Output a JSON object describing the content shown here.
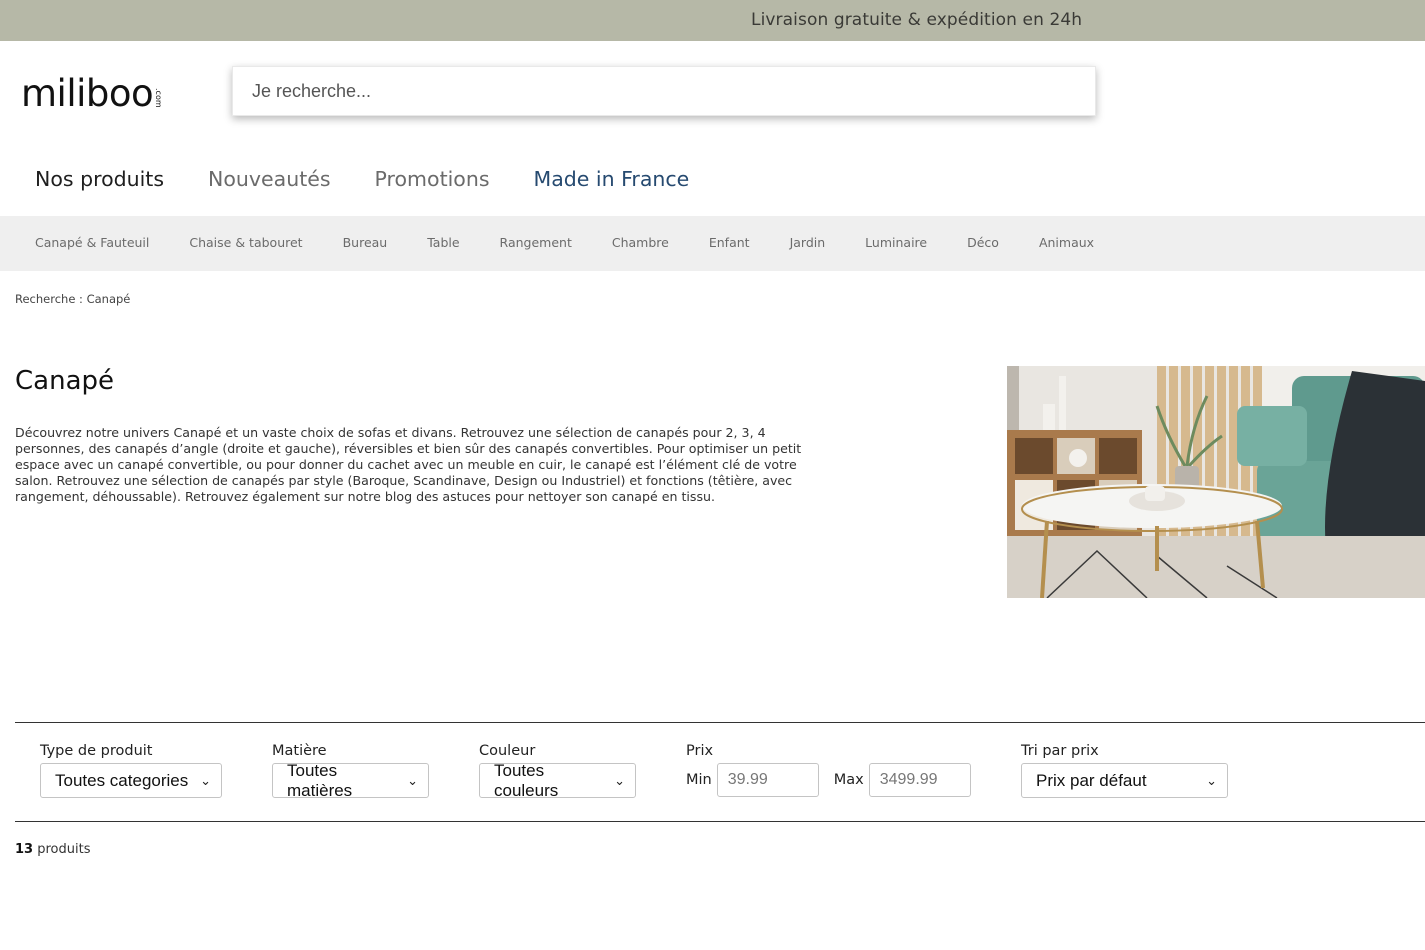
{
  "topbar": {
    "text": "Livraison gratuite & expédition en 24h"
  },
  "logo": {
    "main": "miliboo",
    "suffix": ".com"
  },
  "search": {
    "placeholder": "Je recherche..."
  },
  "main_nav": [
    "Nos produits",
    "Nouveautés",
    "Promotions",
    "Made in France"
  ],
  "categories": [
    "Canapé & Fauteuil",
    "Chaise & tabouret",
    "Bureau",
    "Table",
    "Rangement",
    "Chambre",
    "Enfant",
    "Jardin",
    "Luminaire",
    "Déco",
    "Animaux"
  ],
  "breadcrumb": "Recherche : Canapé",
  "page": {
    "title": "Canapé",
    "description": "Découvrez notre univers Canapé et un vaste choix de sofas et divans. Retrouvez une sélection de canapés pour 2, 3, 4 personnes, des canapés d’angle (droite et gauche), réversibles et bien sûr des canapés convertibles. Pour optimiser un petit espace avec un canapé convertible, ou pour donner du cachet avec un meuble en cuir, le canapé est l’élément clé de votre salon. Retrouvez une sélection de canapés par style (Baroque, Scandinave, Design ou Industriel) et fonctions (têtière, avec rangement, déhoussable). Retrouvez également sur notre blog des astuces pour nettoyer son canapé en tissu."
  },
  "filters": {
    "type": {
      "label": "Type de produit",
      "value": "Toutes categories"
    },
    "material": {
      "label": "Matière",
      "value": "Toutes matières"
    },
    "color": {
      "label": "Couleur",
      "value": "Toutes couleurs"
    },
    "price": {
      "label": "Prix",
      "min_label": "Min",
      "max_label": "Max",
      "min_placeholder": "39.99",
      "max_placeholder": "3499.99"
    },
    "sort": {
      "label": "Tri par prix",
      "value": "Prix par défaut"
    }
  },
  "results": {
    "count": "13",
    "unit": "produits"
  },
  "colors": {
    "topbar": "#b6b8a7",
    "category_bar": "#efefef",
    "accent_nav": "#264a70",
    "sofa": "#5f9a8e"
  }
}
